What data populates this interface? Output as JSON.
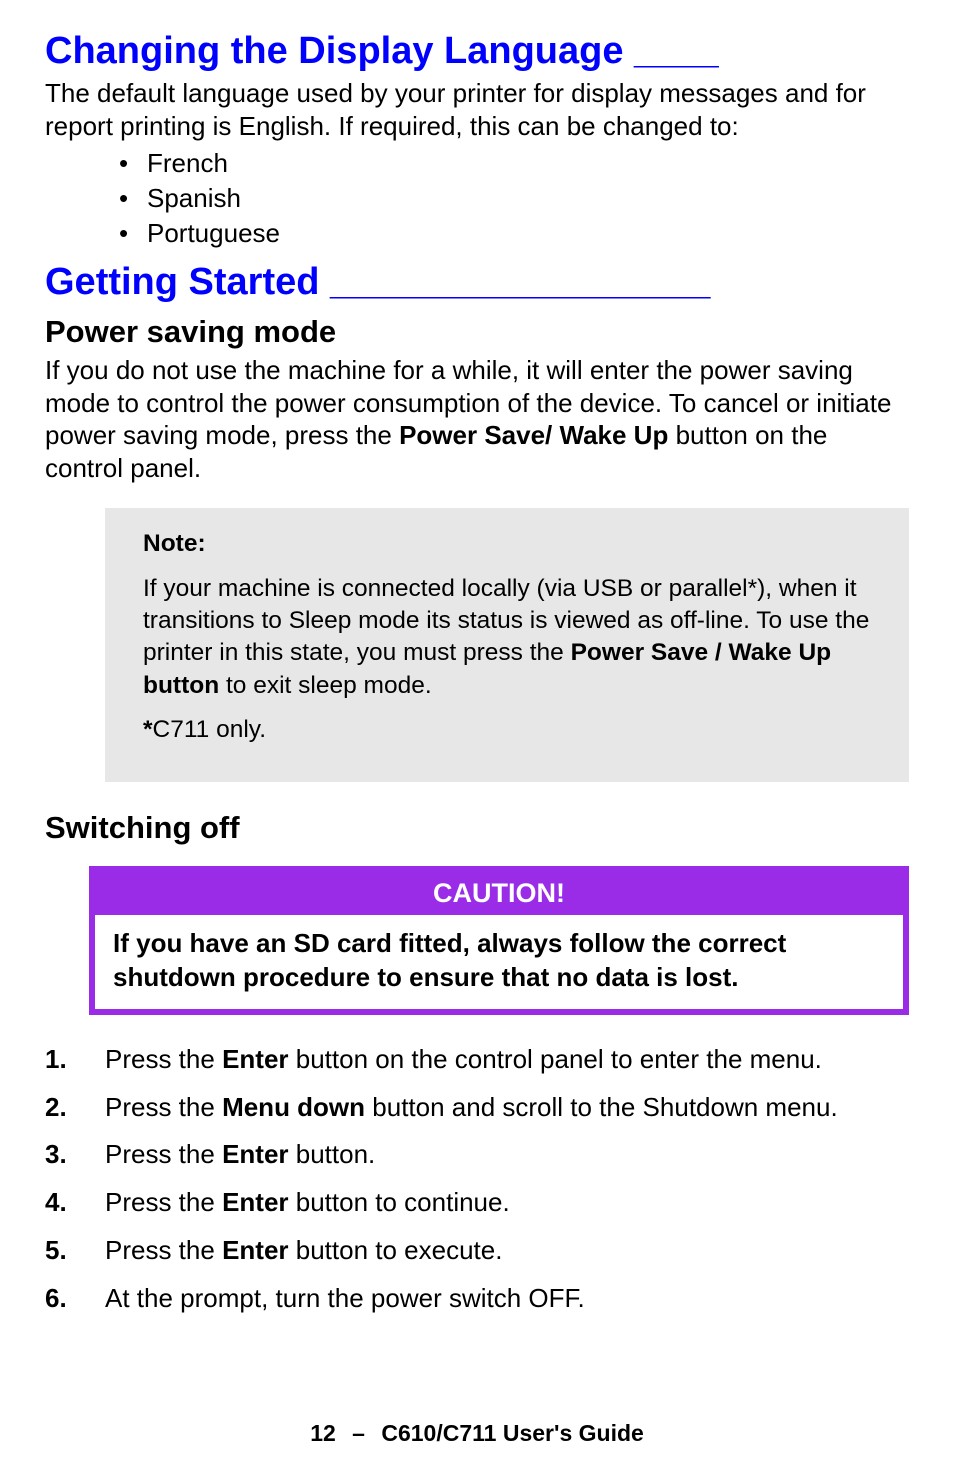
{
  "section1": {
    "heading": "Changing the Display Language ____",
    "intro": "The default language used by your printer for display messages and for report printing is English. If required, this can be changed to:",
    "languages": [
      "French",
      "Spanish",
      "Portuguese"
    ]
  },
  "section2": {
    "heading": "Getting Started __________________",
    "sub1": {
      "heading": "Power saving mode",
      "para_pre": "If you do not use the machine for a while, it will enter the power saving mode to control the power consumption of the device. To cancel or initiate power saving mode, press the ",
      "para_bold": "Power Save/ Wake Up",
      "para_post": " button on the control panel."
    },
    "note": {
      "label": "Note:",
      "body_pre": "If your machine is connected locally (via USB or parallel*), when it transitions to Sleep mode its status is viewed as off-line. To use the printer in this state, you must press the ",
      "body_bold": "Power Save / Wake Up button",
      "body_post": " to exit sleep mode.",
      "footnote_bold": "*",
      "footnote_text": "C711 only."
    },
    "sub2": {
      "heading": "Switching off"
    },
    "caution": {
      "label": "CAUTION!",
      "body": "If you have an SD card fitted, always follow the correct shutdown procedure to ensure that no data is lost."
    },
    "steps": [
      {
        "pre": "Press the ",
        "bold": "Enter",
        "post": " button on the control panel to enter the menu."
      },
      {
        "pre": "Press the ",
        "bold": "Menu down",
        "post": " button and scroll to the Shutdown menu."
      },
      {
        "pre": "Press the ",
        "bold": "Enter",
        "post": " button."
      },
      {
        "pre": "Press the ",
        "bold": "Enter",
        "post": " button to continue."
      },
      {
        "pre": "Press the ",
        "bold": "Enter",
        "post": " button to execute."
      },
      {
        "pre": "At the prompt, turn the power switch OFF.",
        "bold": "",
        "post": ""
      }
    ]
  },
  "footer": {
    "page": "12",
    "sep": "–",
    "title": "C610/C711 User's Guide"
  }
}
